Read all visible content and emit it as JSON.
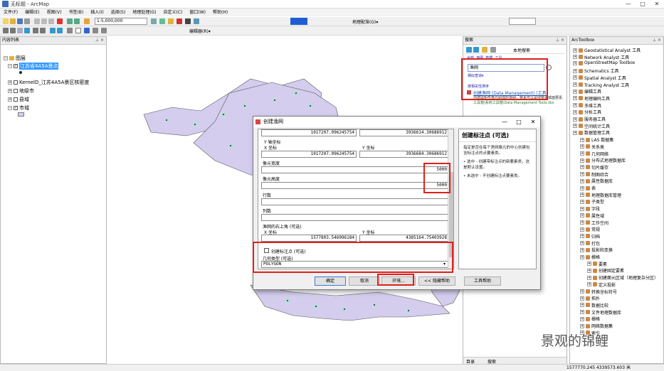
{
  "window": {
    "title": "无标题 - ArcMap",
    "controls": [
      "—",
      "□",
      "✕"
    ]
  },
  "menu": [
    "文件(F)",
    "编辑(E)",
    "视图(V)",
    "书签(B)",
    "插入(I)",
    "选择(S)",
    "地理处理(G)",
    "自定义(C)",
    "窗口(W)",
    "帮助(H)"
  ],
  "toolbar": {
    "scale": "1:5,000,000",
    "georef_label": "地理配准(G)▾",
    "editor_label": "编辑器(R)▾"
  },
  "toc": {
    "title": "内容列表",
    "root": "图层",
    "layers": [
      "江苏省4A5A景点",
      "KernelD_江苏4A5A景区核密度",
      "地级市",
      "县域",
      "市域"
    ]
  },
  "search": {
    "title": "搜索",
    "scope": "本地搜索",
    "query": "渔网",
    "suggest": "相似查询▾",
    "result_title": "创建渔网 (Data Management) (工具)",
    "result_desc1": "创建由矩形像元组成的渔网，要素可以是线要素或面要素。",
    "result_desc2": "工具箱\\系统工具箱\\Data Management Tools.tbx",
    "sort_label": "按相关性排序",
    "tabs": [
      "目录",
      "搜索"
    ]
  },
  "dialog": {
    "title": "创建渔网",
    "fields": {
      "top_x": "1017207.096245754",
      "top_y": "3936614.30686912",
      "y_axis_label": "Y 轴坐标",
      "x_label": "X 坐标",
      "y_label": "Y 坐标",
      "y_axis_x": "1017207.096245754",
      "y_axis_y": "3936684.30686912",
      "cell_width_label": "像元宽度",
      "cell_width": "5000",
      "cell_height_label": "像元高度",
      "cell_height": "5000",
      "rows_label": "行数",
      "cols_label": "列数",
      "opposite_label": "渔网的右上角 (可选)",
      "opp_x": "1577803.546096184",
      "opp_y": "4385164.75403928",
      "create_labels": "创建标注点 (可选)",
      "geom_label": "几何类型 (可选)",
      "geom_value": "POLYGON"
    },
    "buttons": {
      "ok": "确定",
      "cancel": "取消",
      "env": "环境...",
      "hide_help": "<< 隐藏帮助",
      "tool_help": "工具帮助"
    },
    "help_title": "创建标注点 (可选)",
    "help_body": "指定是否在每个渔网像元的中心创建包含标注点的点要素类。",
    "help_bullets": [
      "选中 - 创建带标注点的新要素类，这是默认设置。",
      "未选中 - 不创建标注点要素类。"
    ]
  },
  "toolbox": {
    "title": "ArcToolbox",
    "items": [
      "Geostatistical Analyst 工具",
      "Network Analyst 工具",
      "OpenStreetMap Toolbox",
      "Schematics 工具",
      "Spatial Analyst 工具",
      "Tracking Analyst 工具",
      "编辑工具",
      "地理编码工具",
      "多维工具",
      "分析工具",
      "服务器工具",
      "空间统计工具",
      "数据管理工具",
      "LAS 数据集",
      "关系类",
      "几何网络",
      "分布式地理数据库",
      "切片缓存",
      "制图综合",
      "属性数据库",
      "表",
      "地理数据库管理",
      "子类型",
      "字段",
      "属性域",
      "工作空间",
      "常规",
      "归档",
      "打包",
      "投影和变换",
      "栅格",
      "要素",
      "创建固定要素",
      "创建面元区域（地理复杂分区）",
      "定义投影",
      "转换坐标符号",
      "拓扑",
      "数据比较",
      "文件地理数据库",
      "栅格",
      "网络数据集",
      "索引"
    ]
  },
  "status": {
    "coords": "1577770.245  4339573.603 米"
  },
  "watermark": "景观的锦鲤"
}
